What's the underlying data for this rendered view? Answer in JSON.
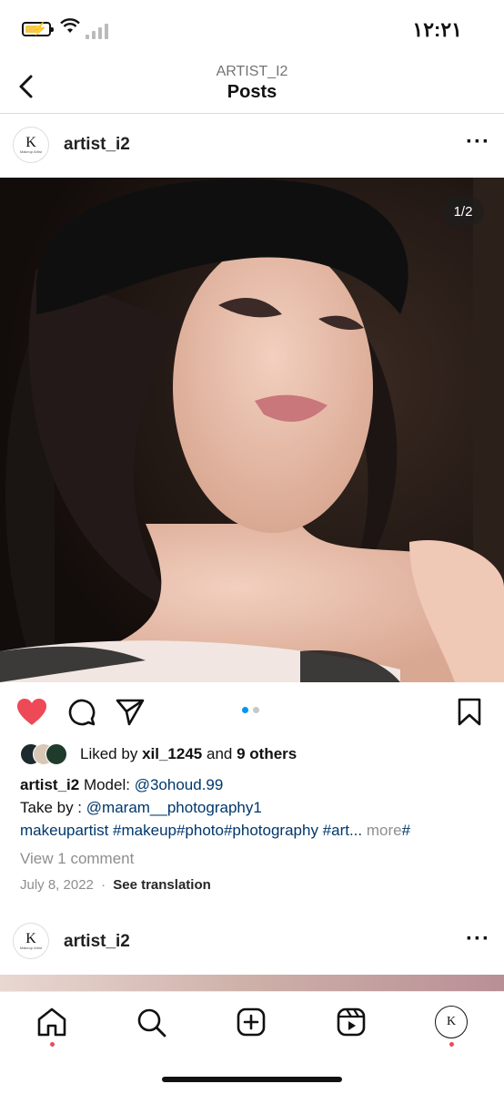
{
  "status_bar": {
    "time": "١٢:٢١"
  },
  "header": {
    "subtitle": "ARTIST_I2",
    "title": "Posts"
  },
  "post": {
    "username": "artist_i2",
    "avatar_letter": "K",
    "avatar_text": "Makeup Artist",
    "image_counter": "1/2",
    "current_page": 1,
    "total_pages": 2,
    "liked_by_prefix": "Liked by",
    "liked_by_user": "xil_1245",
    "liked_by_and": "and",
    "liked_by_others": "9 others",
    "caption_username": "artist_i2",
    "caption_model_label": "Model:",
    "caption_model_mention": "@3ohoud.99",
    "caption_take_by_label": "Take by :",
    "caption_take_by_mention": "@maram__photography1",
    "caption_hashtags": "makeupartist #makeup#photo#photography #art...",
    "caption_more": "more",
    "caption_more_suffix": "#",
    "view_comments": "View 1 comment",
    "date": "July 8, 2022",
    "separator": "·",
    "see_translation": "See translation",
    "liked": true
  },
  "next_post": {
    "username": "artist_i2",
    "avatar_letter": "K"
  },
  "colors": {
    "like_red": "#ed4956",
    "link_blue": "#00376b",
    "dot_active": "#0095f6",
    "muted": "#8e8e8e"
  },
  "tabbar": {
    "items": [
      "home-icon",
      "search-icon",
      "create-icon",
      "reels-icon",
      "profile-avatar"
    ]
  }
}
